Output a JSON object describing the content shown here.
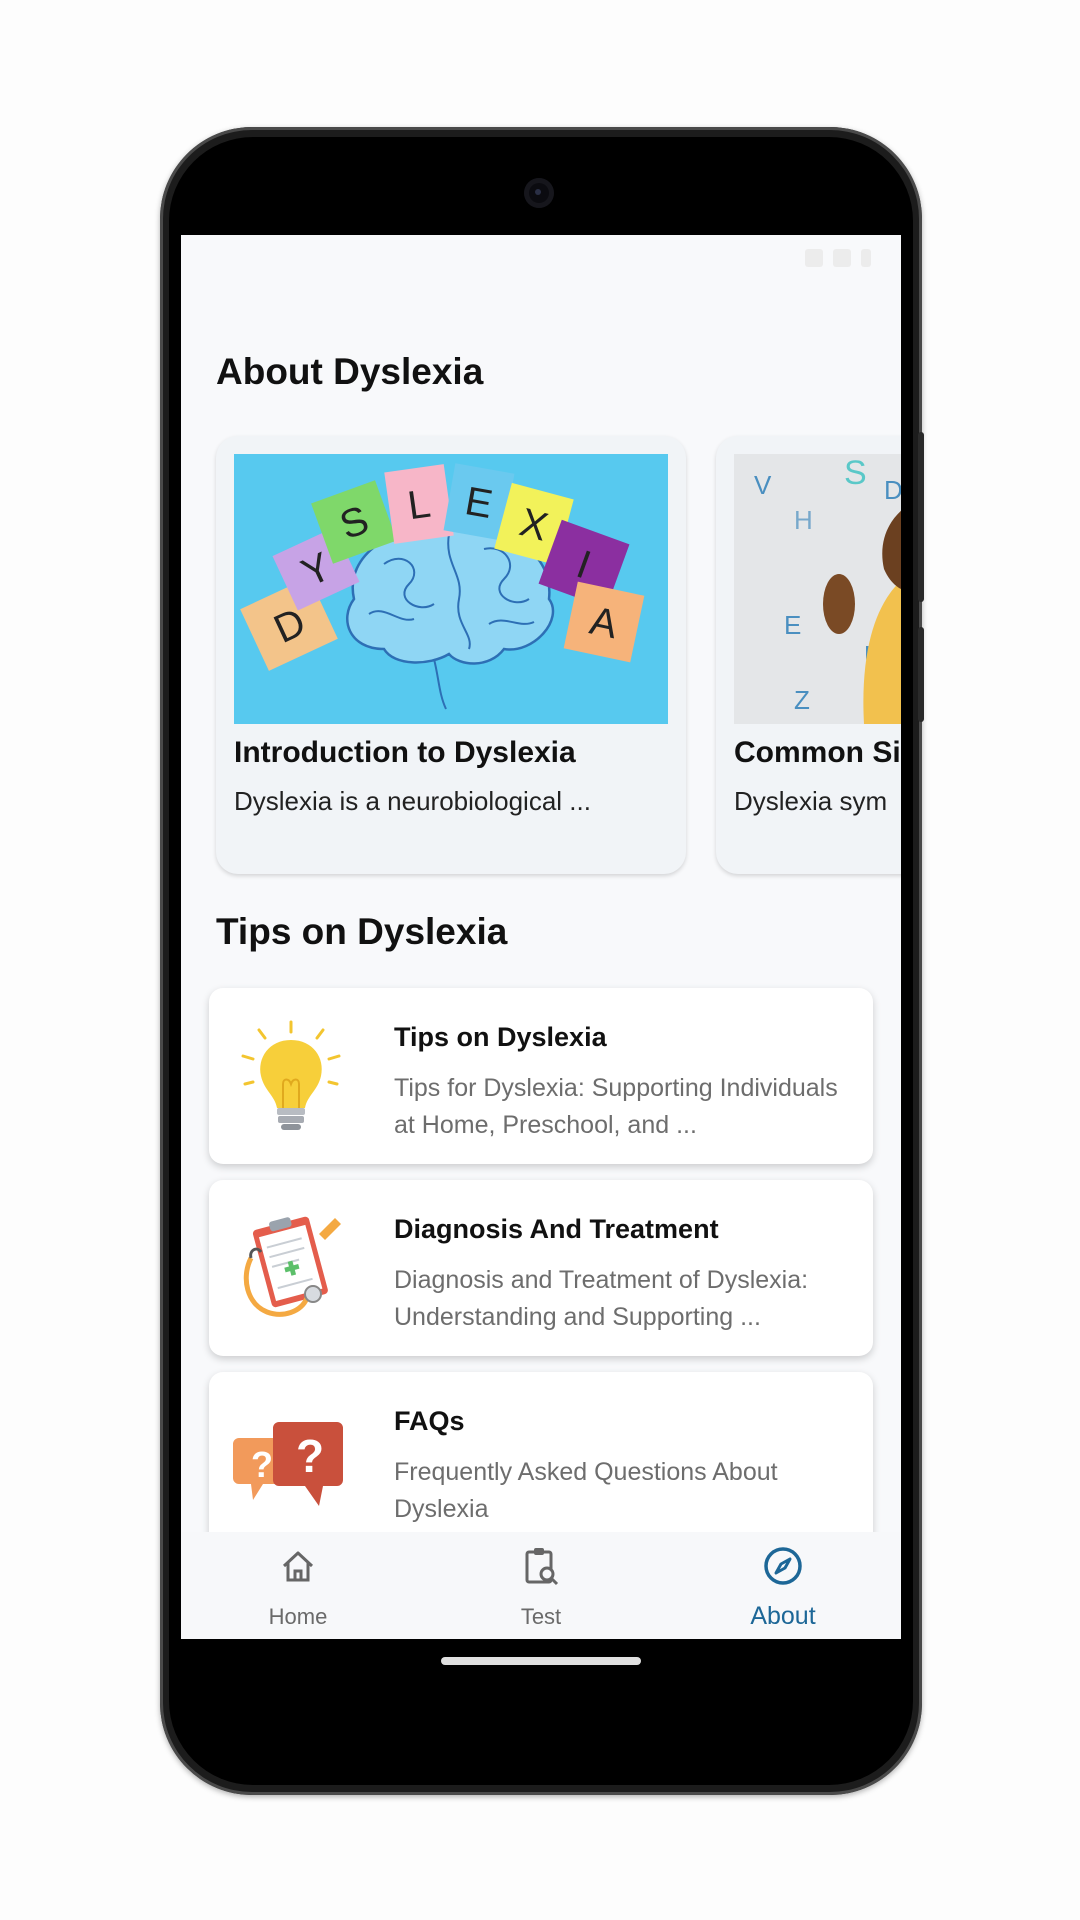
{
  "status": {
    "time": ""
  },
  "sections": {
    "about_title": "About Dyslexia",
    "tips_title": "Tips on Dyslexia"
  },
  "carousel": [
    {
      "title": "Introduction to Dyslexia",
      "description": "Dyslexia is a neurobiological ...",
      "image_letters": [
        "D",
        "Y",
        "S",
        "L",
        "E",
        "X",
        "I",
        "A"
      ]
    },
    {
      "title": "Common Si",
      "description": "Dyslexia sym"
    }
  ],
  "tips": [
    {
      "title": "Tips on Dyslexia",
      "description": "Tips for Dyslexia: Supporting Individuals at Home, Preschool, and ...",
      "icon": "lightbulb-icon"
    },
    {
      "title": "Diagnosis And Treatment",
      "description": "Diagnosis and Treatment of Dyslexia: Understanding and Supporting ...",
      "icon": "clipboard-stethoscope-icon"
    },
    {
      "title": "FAQs",
      "description": "Frequently Asked Questions About Dyslexia",
      "icon": "question-bubbles-icon"
    }
  ],
  "nav": [
    {
      "label": "Home",
      "icon": "home-icon"
    },
    {
      "label": "Test",
      "icon": "clipboard-search-icon"
    },
    {
      "label": "About",
      "icon": "compass-icon",
      "active": true
    }
  ],
  "colors": {
    "accent": "#1d6797",
    "background": "#f8f9fb"
  }
}
